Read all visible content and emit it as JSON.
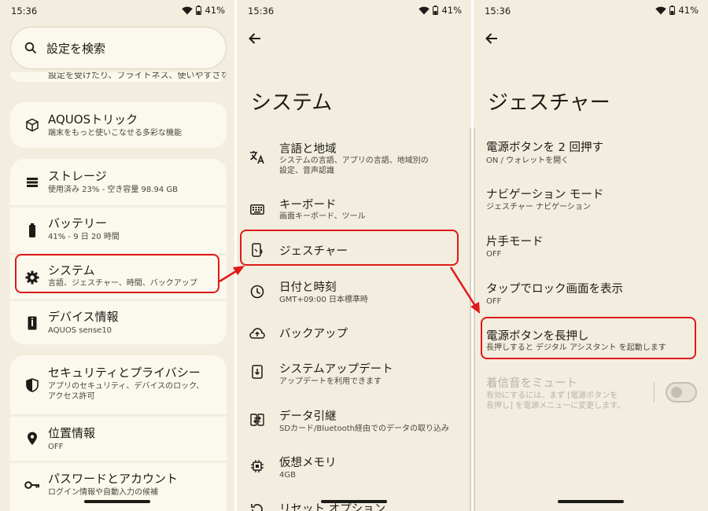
{
  "status": {
    "time": "15:36",
    "battery": "41%"
  },
  "panel1": {
    "search_placeholder": "設定を検索",
    "clipped_fragment": "設定を受けたり、ブライトネス、使いやすさなど",
    "aquos_trick": {
      "title": "AQUOSトリック",
      "sub": "端末をもっと使いこなせる多彩な機能"
    },
    "storage": {
      "title": "ストレージ",
      "sub": "使用済み 23% - 空き容量 98.94 GB"
    },
    "battery": {
      "title": "バッテリー",
      "sub": "41% - 9 日 20 時間"
    },
    "system": {
      "title": "システム",
      "sub": "言語、ジェスチャー、時間、バックアップ"
    },
    "device_info": {
      "title": "デバイス情報",
      "sub": "AQUOS sense10"
    },
    "security": {
      "title": "セキュリティとプライバシー",
      "sub1": "アプリのセキュリティ、デバイスのロック、",
      "sub2": "アクセス許可"
    },
    "location": {
      "title": "位置情報",
      "sub": "OFF"
    },
    "passwords": {
      "title": "パスワードとアカウント",
      "sub": "ログイン情報や自動入力の候補"
    }
  },
  "panel2": {
    "title": "システム",
    "items": [
      {
        "icon": "translate-icon",
        "title": "言語と地域",
        "sub1": "システムの言語、アプリの言語、地域別の",
        "sub2": "設定、音声認識"
      },
      {
        "icon": "keyboard-icon",
        "title": "キーボード",
        "sub1": "画面キーボード、ツール"
      },
      {
        "icon": "gesture-icon",
        "title": "ジェスチャー"
      },
      {
        "icon": "clock-icon",
        "title": "日付と時刻",
        "sub1": "GMT+09:00 日本標準時"
      },
      {
        "icon": "backup-icon",
        "title": "バックアップ"
      },
      {
        "icon": "system-update-icon",
        "title": "システムアップデート",
        "sub1": "アップデートを利用できます"
      },
      {
        "icon": "data-transfer-icon",
        "title": "データ引継",
        "sub1": "SDカード/Bluetooth経由でのデータの取り込み"
      },
      {
        "icon": "memory-icon",
        "title": "仮想メモリ",
        "sub1": "4GB"
      },
      {
        "icon": "reset-icon",
        "title": "リセット オプション"
      }
    ]
  },
  "panel3": {
    "title": "ジェスチャー",
    "items": [
      {
        "title": "電源ボタンを 2 回押す",
        "sub1": "ON / ウォレットを開く"
      },
      {
        "title": "ナビゲーション モード",
        "sub1": "ジェスチャー ナビゲーション"
      },
      {
        "title": "片手モード",
        "sub1": "OFF"
      },
      {
        "title": "タップでロック画面を表示",
        "sub1": "OFF"
      },
      {
        "title": "電源ボタンを長押し",
        "sub1": "長押しすると デジタル アシスタント を起動します"
      },
      {
        "title": "着信音をミュート",
        "sub1": "有効にするには、まず [電源ボタンを",
        "sub2": "長押し] を電源メニューに変更します。"
      }
    ]
  },
  "colors": {
    "highlight": "#e01919",
    "panel_bg": "#f2edde",
    "card_bg": "#fbf8ee"
  }
}
